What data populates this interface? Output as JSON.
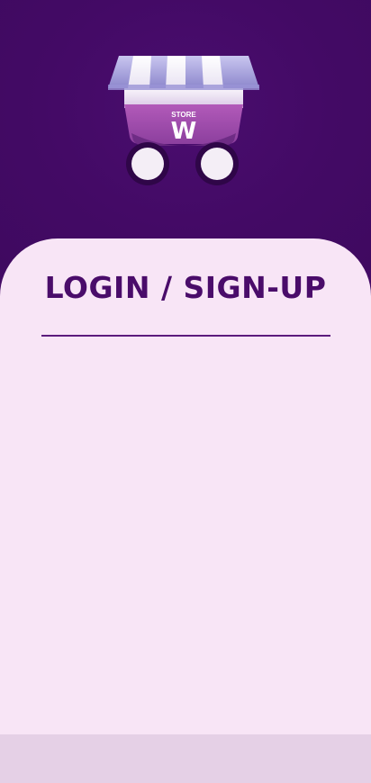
{
  "header": {
    "logo_icon": "store-cart-logo-icon",
    "logo_text_small": "STORE",
    "logo_text_large": "W"
  },
  "card": {
    "title": "LOGIN / SIGN-UP"
  },
  "colors": {
    "brand_dark": "#440b66",
    "card_bg": "#f8e5f6",
    "title": "#4a0c6a",
    "bottom_bar": "#e5d0e6"
  }
}
